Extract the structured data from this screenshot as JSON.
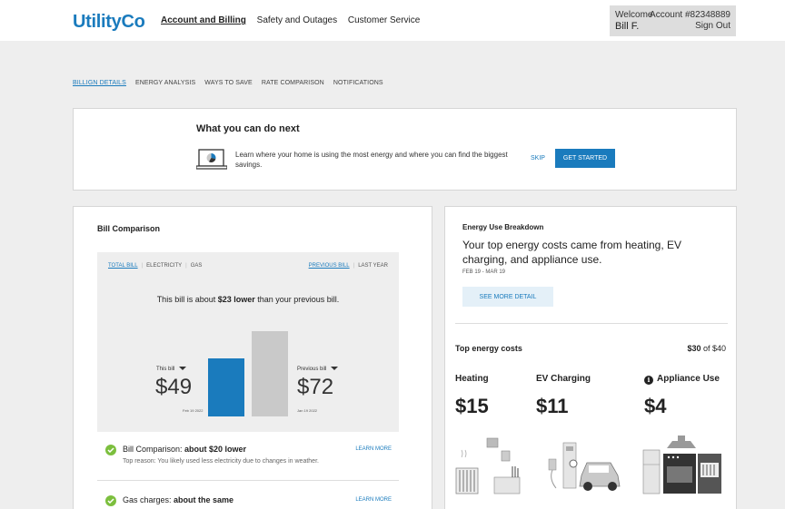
{
  "header": {
    "logo": "UtilityCo",
    "nav": [
      "Account and Billing",
      "Safety and Outages",
      "Customer Service"
    ],
    "welcome_label": "Welcome",
    "user_name": "Bill F.",
    "account_label": "Account #82348889",
    "sign_out": "Sign Out"
  },
  "tabs": [
    "BILLIGN DETAILS",
    "ENERGY ANALYSIS",
    "WAYS TO SAVE",
    "RATE COMPARISON",
    "NOTIFICATIONS"
  ],
  "next": {
    "title": "What you can do next",
    "description": "Learn where your home is using the most energy and where you can find the biggest savings.",
    "skip": "SKIP",
    "cta": "GET STARTED"
  },
  "bill": {
    "title": "Bill Comparison",
    "toggles_left": [
      "TOTAL BILL",
      "ELECTRICITY",
      "GAS"
    ],
    "toggles_right": [
      "PREVIOUS BILL",
      "LAST YEAR"
    ],
    "summary_prefix": "This bill is about ",
    "summary_bold": "$23 lower",
    "summary_suffix": " than your previous bill.",
    "this_label": "This bill",
    "this_amount": "$49",
    "this_date": "Feb 19 2022",
    "prev_label": "Previous bill",
    "prev_amount": "$72",
    "prev_date": "Jan 19 2022",
    "rows": [
      {
        "title": "Bill Comparison: ",
        "bold": "about $20 lower",
        "detail": "Top reason: You likely used less electricity due to changes in weather.",
        "link": "LEARN MORE"
      },
      {
        "title": "Gas charges: ",
        "bold": "about the same",
        "detail": "",
        "link": "LEARN MORE"
      }
    ]
  },
  "energy": {
    "title": "Energy Use Breakdown",
    "headline": "Your top energy costs came from heating, EV charging, and appliance use.",
    "range": "FEB 19 - MAR 19",
    "see_more": "SEE MORE DETAIL",
    "top_costs": "Top energy costs",
    "budget_bold": "$30",
    "budget_rest": " of $40",
    "categories": [
      {
        "name": "Heating",
        "cost": "$15"
      },
      {
        "name": "EV Charging",
        "cost": "$11"
      },
      {
        "name": "Appliance Use",
        "cost": "$4"
      }
    ]
  },
  "colors": {
    "brand": "#1a7bbd",
    "positive": "#7cbf3e",
    "background": "#eeeeee"
  }
}
